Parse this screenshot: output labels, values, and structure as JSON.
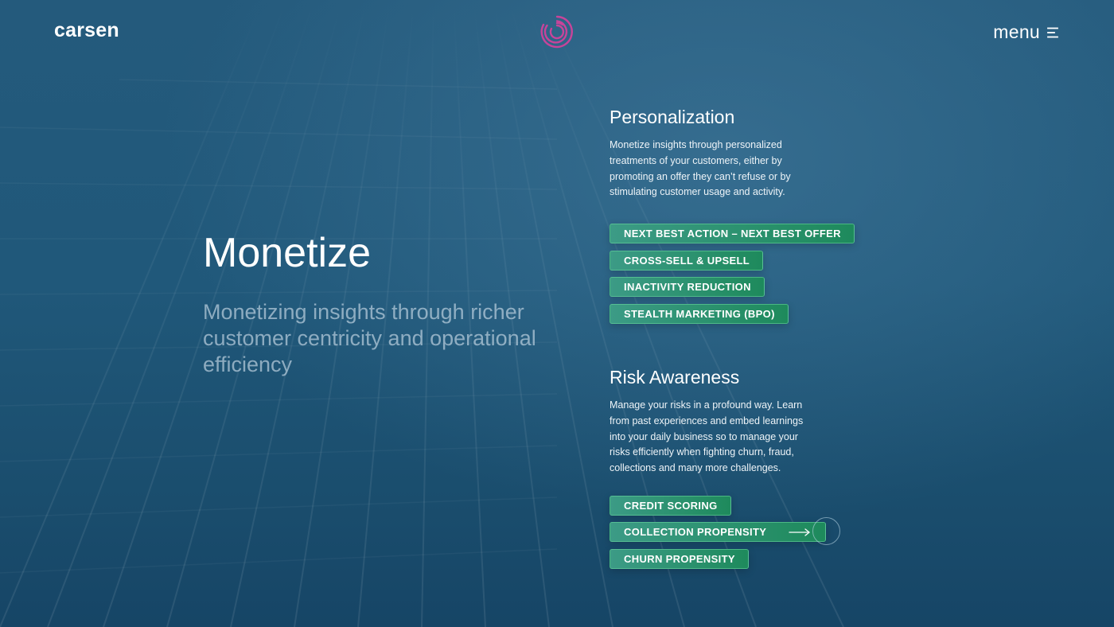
{
  "header": {
    "logo": "carsen",
    "menu_label": "menu"
  },
  "icons": {
    "brand_mark": "c-spiral-logo-icon",
    "menu": "hamburger-menu-icon",
    "arrow": "arrow-right-icon"
  },
  "colors": {
    "background": "#1d4f70",
    "brand_mark": "#c7449a",
    "tag_start": "#3c9b86",
    "tag_end": "#1e8a5c"
  },
  "hero": {
    "title": "Monetize",
    "subtitle": "Monetizing insights through richer customer centricity and operational efficiency"
  },
  "personalization": {
    "title": "Personalization",
    "description": "Monetize insights through personalized treatments of your customers, either by promoting an offer they can’t refuse or by stimulating customer usage and activity.",
    "tags": [
      "NEXT BEST ACTION – NEXT BEST OFFER",
      "CROSS-SELL & UPSELL",
      "INACTIVITY REDUCTION",
      "STEALTH MARKETING (BPO)"
    ]
  },
  "risk": {
    "title": "Risk Awareness",
    "description": "Manage your risks in a profound way. Learn from past experiences and embed learnings into your daily business so to manage your risks efficiently when fighting churn, fraud, collections and many more challenges.",
    "tags": [
      "CREDIT SCORING",
      "COLLECTION PROPENSITY",
      "CHURN PROPENSITY"
    ]
  }
}
